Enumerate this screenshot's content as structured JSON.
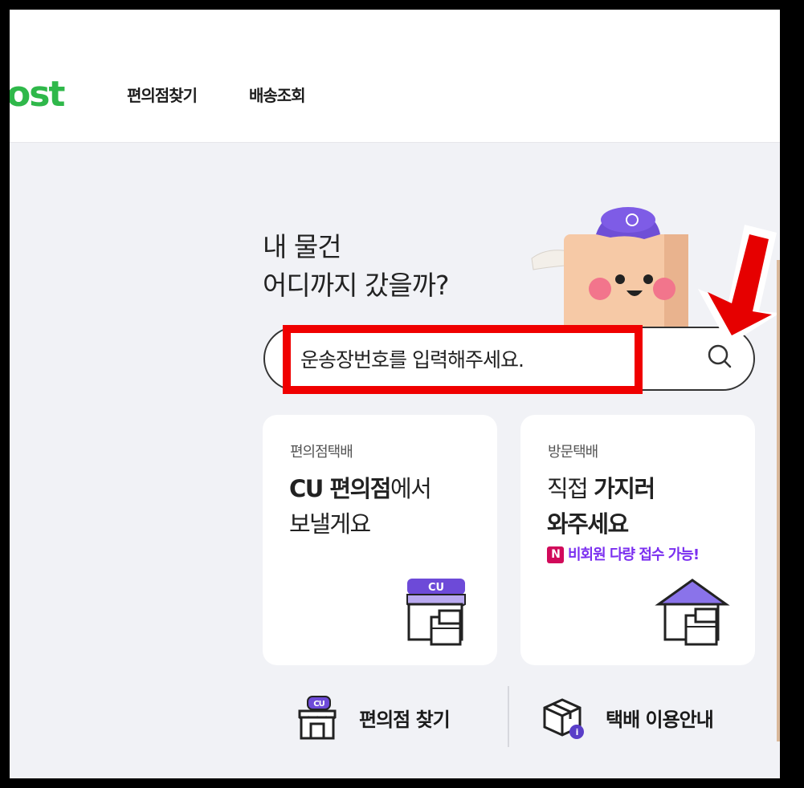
{
  "header": {
    "logo_text": "ost",
    "nav": [
      {
        "label": "편의점찾기"
      },
      {
        "label": "배송조회"
      }
    ]
  },
  "hero": {
    "line1": "내 물건",
    "line2": "어디까지 갔을까?"
  },
  "search": {
    "value": "운송장번호를 입력해주세요.",
    "icon": "search-icon",
    "highlight_color": "#f00000"
  },
  "cards": {
    "cu": {
      "subtitle": "편의점택배",
      "title_bold": "CU 편의점",
      "title_rest": "에서",
      "title_line2": "보낼게요",
      "illustration_label": "CU"
    },
    "visit": {
      "subtitle": "방문택배",
      "title_plain": "직접 ",
      "title_bold": "가지러",
      "title_line2": "와주세요",
      "badge_letter": "N",
      "badge_text": "비회원 다량 접수 가능!"
    }
  },
  "bottom_links": {
    "find_store": {
      "label": "편의점 찾기",
      "icon_label": "CU"
    },
    "guide": {
      "label": "택배 이용안내",
      "icon_badge": "i"
    }
  },
  "colors": {
    "brand_green": "#2fb84a",
    "accent_purple": "#7b2ff0",
    "annotation_red": "#f00000",
    "background": "#f1f2f6"
  }
}
